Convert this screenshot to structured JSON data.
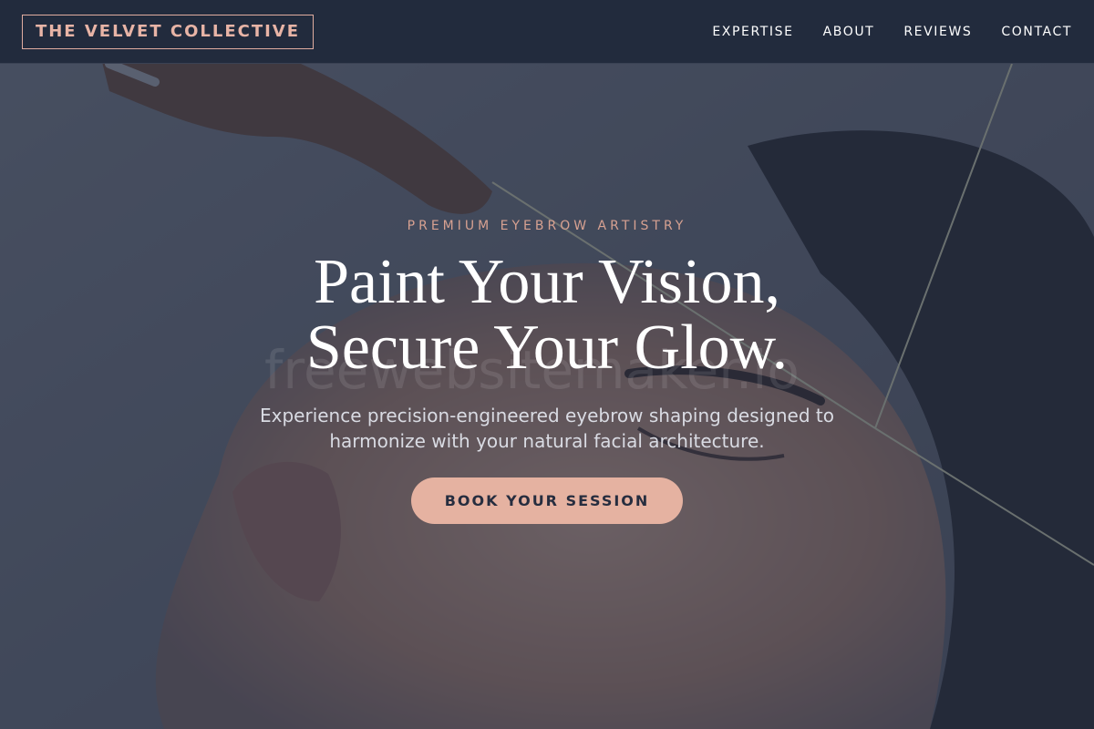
{
  "nav": {
    "logo": "THE VELVET COLLECTIVE",
    "links": [
      "EXPERTISE",
      "ABOUT",
      "REVIEWS",
      "CONTACT"
    ]
  },
  "hero": {
    "eyebrow": "PREMIUM EYEBROW ARTISTRY",
    "headline_line1": "Paint Your Vision,",
    "headline_line2": "Secure Your Glow.",
    "subtext": "Experience precision-engineered eyebrow shaping designed to harmonize with your natural facial architecture.",
    "cta_label": "BOOK YOUR SESSION",
    "watermark": "freewebsitemaker.io"
  },
  "colors": {
    "nav_bg": "#222b3d",
    "accent": "#e5b2a1",
    "logo_text": "#e8b4a6",
    "cta_text": "#262d3f"
  }
}
